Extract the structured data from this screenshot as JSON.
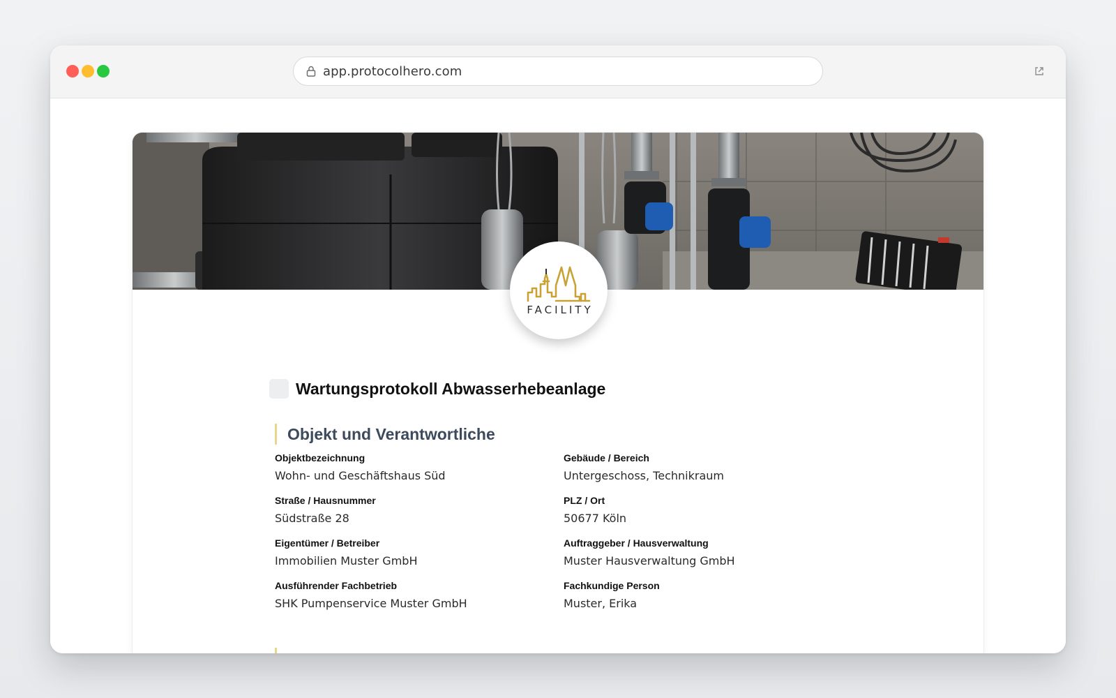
{
  "browser": {
    "url": "app.protocolhero.com"
  },
  "logo": {
    "text": "FACILITY",
    "accent_color": "#c9a236"
  },
  "document": {
    "title": "Wartungsprotokoll Abwasserhebeanlage"
  },
  "section": {
    "title": "Objekt und Verantwortliche",
    "accent_color": "#e8d58e",
    "fields": [
      {
        "label": "Objektbezeichnung",
        "value": "Wohn- und Geschäftshaus Süd"
      },
      {
        "label": "Gebäude / Bereich",
        "value": "Untergeschoss, Technikraum"
      },
      {
        "label": "Straße / Hausnummer",
        "value": "Südstraße 28"
      },
      {
        "label": "PLZ / Ort",
        "value": "50677 Köln"
      },
      {
        "label": "Eigentümer / Betreiber",
        "value": "Immobilien Muster GmbH"
      },
      {
        "label": "Auftraggeber / Hausverwaltung",
        "value": "Muster Hausverwaltung GmbH"
      },
      {
        "label": "Ausführender Fachbetrieb",
        "value": "SHK Pumpenservice Muster GmbH"
      },
      {
        "label": "Fachkundige Person",
        "value": "Muster, Erika"
      }
    ]
  }
}
